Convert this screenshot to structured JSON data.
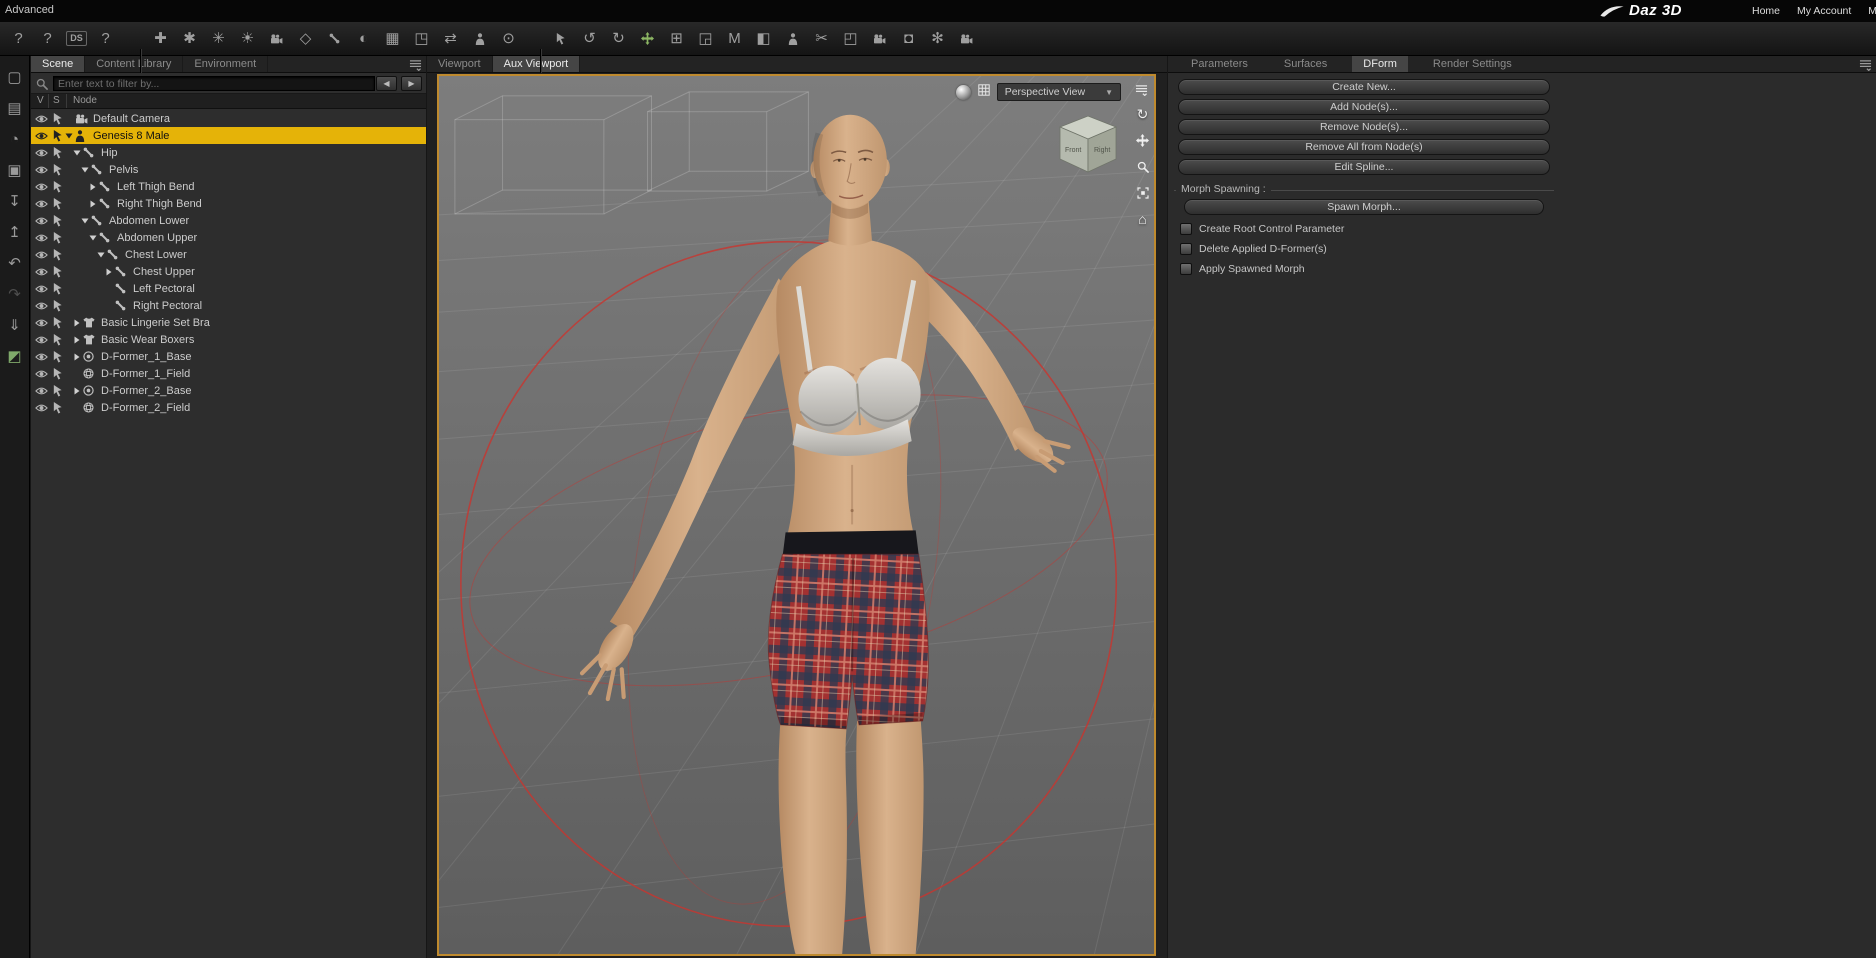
{
  "topbar": {
    "mode_label": "Advanced",
    "brand": "Daz 3D",
    "nav": [
      {
        "label": "Home"
      },
      {
        "label": "My Account"
      },
      {
        "label": "My Ga"
      }
    ]
  },
  "toolbar": {
    "help_group": [
      {
        "name": "whats-this-icon",
        "text": "?"
      },
      {
        "name": "help-icon",
        "text": "?"
      },
      {
        "name": "daz-studio-docs-icon",
        "text": "DS"
      },
      {
        "name": "tutorials-icon",
        "text": "?"
      }
    ],
    "create_group": [
      {
        "name": "create-figure-icon",
        "text": "✚"
      },
      {
        "name": "create-group-icon",
        "text": "✱"
      },
      {
        "name": "create-instance-icon",
        "text": "✳"
      },
      {
        "name": "create-light-icon",
        "text": "☀"
      },
      {
        "name": "create-camera-icon",
        "svg": "camera"
      },
      {
        "name": "create-primitive-icon",
        "text": "◇"
      },
      {
        "name": "joint-editor-icon",
        "svg": "bone"
      },
      {
        "name": "weight-map-icon",
        "text": "◐"
      },
      {
        "name": "geometry-editor-icon",
        "text": "▦"
      },
      {
        "name": "polygon-group-icon",
        "text": "◳"
      },
      {
        "name": "transfer-utility-icon",
        "text": "⇄"
      },
      {
        "name": "figure-setup-icon",
        "svg": "person"
      },
      {
        "name": "target-icon",
        "text": "⊙"
      }
    ],
    "tool_group": [
      {
        "name": "node-selection-icon",
        "svg": "cursor"
      },
      {
        "name": "rotate-tool-icon",
        "text": "↺"
      },
      {
        "name": "orbit-tool-icon",
        "text": "↻"
      },
      {
        "name": "universal-tool-icon",
        "svg": "cross",
        "accent": true
      },
      {
        "name": "translate-tool-icon",
        "text": "⊞"
      },
      {
        "name": "scale-tool-icon",
        "text": "◲"
      },
      {
        "name": "measure-metrics-icon",
        "text": "M"
      },
      {
        "name": "surface-selection-icon",
        "text": "◧"
      },
      {
        "name": "figure-icon",
        "svg": "person"
      },
      {
        "name": "geometry-cutout-icon",
        "text": "✂"
      },
      {
        "name": "region-navigator-icon",
        "text": "◰"
      },
      {
        "name": "camera-icon",
        "svg": "camera"
      },
      {
        "name": "spot-render-icon",
        "text": "◘"
      },
      {
        "name": "tool-settings-icon",
        "text": "✻"
      },
      {
        "name": "render-icon",
        "svg": "camera"
      }
    ]
  },
  "left_strip": [
    {
      "name": "new-file-icon",
      "text": "▢"
    },
    {
      "name": "open-file-icon",
      "text": "▤"
    },
    {
      "name": "render-queue-icon",
      "text": "◔"
    },
    {
      "name": "save-icon",
      "text": "▣"
    },
    {
      "name": "import-icon",
      "text": "↧"
    },
    {
      "name": "export-icon",
      "text": "↥"
    },
    {
      "name": "undo-icon",
      "text": "↶"
    },
    {
      "name": "redo-icon",
      "text": "↷",
      "disabled": true
    },
    {
      "name": "download-icon",
      "text": "⇓"
    },
    {
      "name": "bridge-icon",
      "text": "◩",
      "accent": true
    }
  ],
  "scene_panel": {
    "tabs": [
      {
        "label": "Scene",
        "active": true
      },
      {
        "label": "Content Library",
        "active": false
      },
      {
        "label": "Environment",
        "active": false
      }
    ],
    "filter_placeholder": "Enter text to filter by...",
    "filter_nav": {
      "prev": "◀",
      "next": "▶"
    },
    "columns": [
      "V",
      "S",
      "Node"
    ],
    "tree": [
      {
        "label": "Default Camera",
        "depth": 0,
        "icon": "camera",
        "expander": "none"
      },
      {
        "label": "Genesis 8 Male",
        "depth": 0,
        "icon": "person",
        "expander": "down",
        "selected": true
      },
      {
        "label": "Hip",
        "depth": 1,
        "icon": "bone",
        "expander": "down"
      },
      {
        "label": "Pelvis",
        "depth": 2,
        "icon": "bone",
        "expander": "down"
      },
      {
        "label": "Left Thigh Bend",
        "depth": 3,
        "icon": "bone",
        "expander": "right"
      },
      {
        "label": "Right Thigh Bend",
        "depth": 3,
        "icon": "bone",
        "expander": "right"
      },
      {
        "label": "Abdomen Lower",
        "depth": 2,
        "icon": "bone",
        "expander": "down"
      },
      {
        "label": "Abdomen Upper",
        "depth": 3,
        "icon": "bone",
        "expander": "down"
      },
      {
        "label": "Chest Lower",
        "depth": 4,
        "icon": "bone",
        "expander": "down"
      },
      {
        "label": "Chest Upper",
        "depth": 5,
        "icon": "bone",
        "expander": "right"
      },
      {
        "label": "Left Pectoral",
        "depth": 5,
        "icon": "bone",
        "expander": "none"
      },
      {
        "label": "Right Pectoral",
        "depth": 5,
        "icon": "bone",
        "expander": "none"
      },
      {
        "label": "Basic Lingerie Set Bra",
        "depth": 1,
        "icon": "shirt",
        "expander": "right"
      },
      {
        "label": "Basic Wear Boxers",
        "depth": 1,
        "icon": "shirt",
        "expander": "right"
      },
      {
        "label": "D-Former_1_Base",
        "depth": 1,
        "icon": "dbase",
        "expander": "right"
      },
      {
        "label": "D-Former_1_Field",
        "depth": 1,
        "icon": "dfield",
        "expander": "none"
      },
      {
        "label": "D-Former_2_Base",
        "depth": 1,
        "icon": "dbase",
        "expander": "right"
      },
      {
        "label": "D-Former_2_Field",
        "depth": 1,
        "icon": "dfield",
        "expander": "none"
      }
    ]
  },
  "viewport": {
    "tabs": [
      {
        "label": "Viewport",
        "active": false
      },
      {
        "label": "Aux Viewport",
        "active": true
      }
    ],
    "view_selector": {
      "label": "Perspective View"
    },
    "cube": {
      "front_label": "Front",
      "right_label": "Right"
    },
    "nav_icons": [
      {
        "name": "rotate-view-icon",
        "text": "↻"
      },
      {
        "name": "pan-view-icon",
        "svg": "cross"
      },
      {
        "name": "zoom-view-icon",
        "svg": "magnifier"
      },
      {
        "name": "frame-view-icon",
        "svg": "frame"
      },
      {
        "name": "home-view-icon",
        "text": "⌂"
      }
    ]
  },
  "right_panel": {
    "tabs": [
      {
        "label": "Parameters",
        "active": false
      },
      {
        "label": "Surfaces",
        "active": false
      },
      {
        "label": "DForm",
        "active": true
      },
      {
        "label": "Render Settings",
        "active": false
      }
    ],
    "buttons": [
      {
        "label": "Create New..."
      },
      {
        "label": "Add Node(s)..."
      },
      {
        "label": "Remove Node(s)..."
      },
      {
        "label": "Remove All from Node(s)"
      },
      {
        "label": "Edit Spline..."
      }
    ],
    "morph_group": {
      "label": "Morph Spawning :",
      "button": "Spawn Morph...",
      "checkboxes": [
        {
          "label": "Create Root Control Parameter",
          "checked": false
        },
        {
          "label": "Delete Applied D-Former(s)",
          "checked": false
        },
        {
          "label": "Apply Spawned Morph",
          "checked": false
        }
      ]
    }
  },
  "colors": {
    "selection": "#e5b308",
    "viewport_border": "#bf8a2e",
    "dformer_field": "#c9342e"
  }
}
